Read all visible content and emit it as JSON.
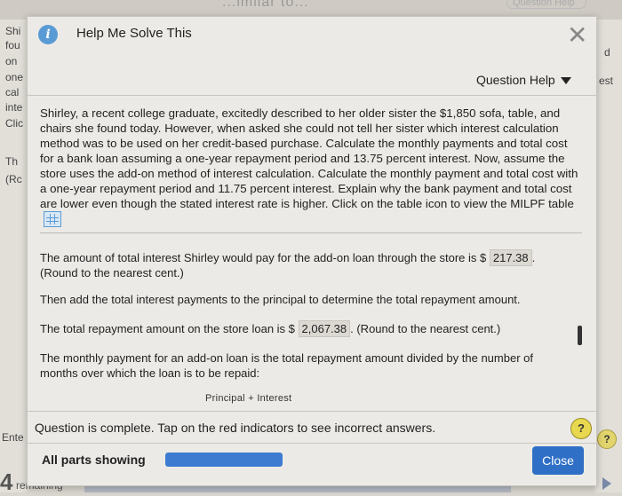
{
  "background": {
    "title_fragment": "...imilar to...",
    "question_help_fragment": "Question Help",
    "left_words": [
      "Shi",
      "fou",
      "on",
      "one",
      "cal",
      "inte",
      "Clic",
      "Th",
      "(Rc"
    ],
    "right_words": [
      "d",
      "est"
    ],
    "enter_fragment": "Ente",
    "remaining_count": "4",
    "remaining_label": "remaining",
    "help_symbol": "?"
  },
  "modal": {
    "title": "Help Me Solve This",
    "info_symbol": "i",
    "close_symbol": "✕",
    "question_help_label": "Question Help",
    "question_text": "Shirley, a recent college graduate, excitedly described to her older sister the $1,850 sofa, table, and chairs she found today. However, when asked she could not tell her sister which interest calculation method was to be used on her credit-based purchase. Calculate the monthly payments and total cost for a bank loan assuming a one-year repayment period and 13.75 percent interest. Now, assume the store uses the add-on method of interest calculation. Calculate the monthly payment and total cost with a one-year repayment period and 11.75 percent interest. Explain why the bank payment and total cost are lower even though the stated interest rate is higher. Click on the table icon to view the MILPF table",
    "answers": {
      "a1_prefix": "The amount of total interest Shirley would pay for the add-on loan through the store is $",
      "a1_value": "217.38",
      "a1_suffix": ".",
      "a1_note": "(Round to the nearest cent.)",
      "a2": "Then add the total interest payments to the principal to determine the total repayment amount.",
      "a3_prefix": "The total repayment amount on the store loan is $",
      "a3_value": "2,067.38",
      "a3_suffix": ". (Round to the nearest cent.)",
      "a4": "The monthly payment for an add-on loan is the total repayment amount divided by the number of months over which the loan is to be repaid:",
      "formula": "Principal + Interest"
    },
    "status_message": "Question is complete. Tap on the red indicators to see incorrect answers.",
    "help_symbol": "?",
    "parts_label": "All parts showing",
    "progress_fraction": 1.0,
    "close_label": "Close",
    "accent_color": "#2f6fc6"
  }
}
